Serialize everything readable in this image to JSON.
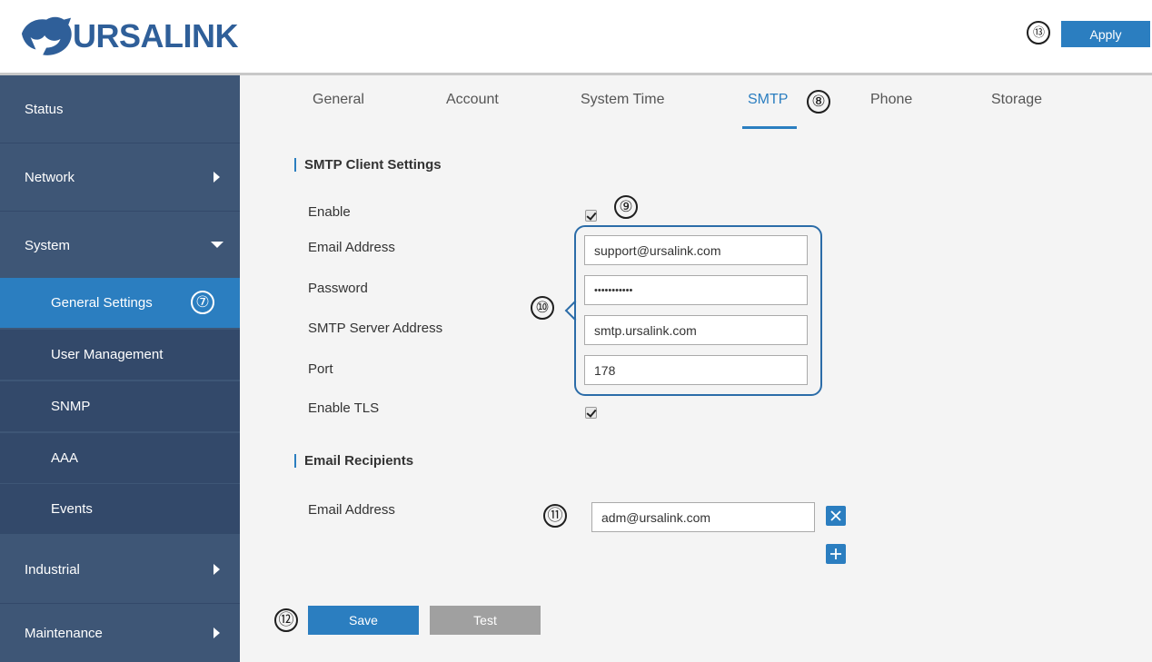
{
  "header": {
    "logo_text": "URSALINK",
    "apply_label": "Apply",
    "markers": {
      "apply": "⑬"
    }
  },
  "sidebar": {
    "items": [
      {
        "label": "Status"
      },
      {
        "label": "Network"
      },
      {
        "label": "System"
      },
      {
        "label": "General Settings"
      },
      {
        "label": "User Management"
      },
      {
        "label": "SNMP"
      },
      {
        "label": "AAA"
      },
      {
        "label": "Events"
      },
      {
        "label": "Industrial"
      },
      {
        "label": "Maintenance"
      }
    ],
    "markers": {
      "general_settings": "⑦"
    }
  },
  "tabs": {
    "items": [
      {
        "label": "General"
      },
      {
        "label": "Account"
      },
      {
        "label": "System Time"
      },
      {
        "label": "SMTP"
      },
      {
        "label": "Phone"
      },
      {
        "label": "Storage"
      }
    ],
    "active": "SMTP",
    "markers": {
      "smtp": "⑧"
    }
  },
  "smtp_client": {
    "title": "SMTP Client Settings",
    "enable_label": "Enable",
    "enable_checked": true,
    "email_label": "Email Address",
    "email_value": "support@ursalink.com",
    "password_label": "Password",
    "password_value": "•••••••••••",
    "server_label": "SMTP Server Address",
    "server_value": "smtp.ursalink.com",
    "port_label": "Port",
    "port_value": "178",
    "tls_label": "Enable TLS",
    "tls_checked": true,
    "markers": {
      "enable": "⑨",
      "fields": "⑩"
    }
  },
  "recipients": {
    "title": "Email Recipients",
    "email_label": "Email Address",
    "email_value": "adm@ursalink.com",
    "markers": {
      "email": "⑪"
    }
  },
  "actions": {
    "save_label": "Save",
    "test_label": "Test",
    "markers": {
      "save": "⑫"
    }
  },
  "colors": {
    "accent": "#2b7ec0",
    "sidebar_bg": "#3e5676",
    "sidebar_sub_bg": "#33496a",
    "content_bg": "#f4f4f4"
  }
}
